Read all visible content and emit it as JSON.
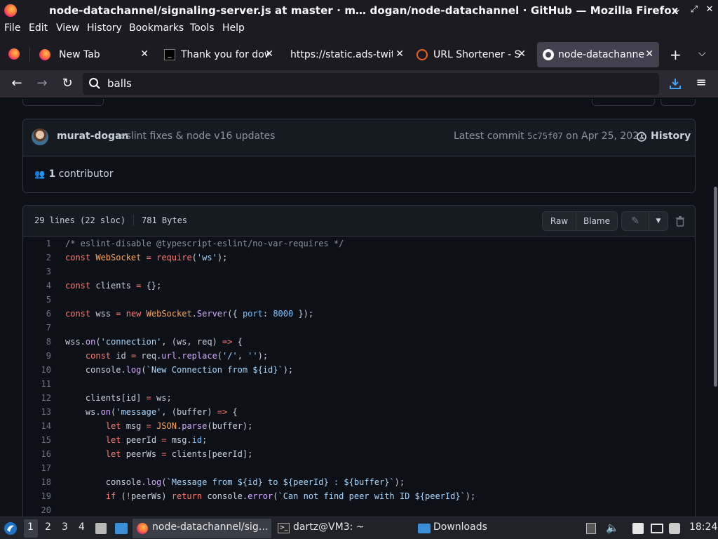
{
  "window": {
    "title": "node-datachannel/signaling-server.js at master · m…  dogan/node-datachannel · GitHub — Mozilla Firefox"
  },
  "menubar": [
    "File",
    "Edit",
    "View",
    "History",
    "Bookmarks",
    "Tools",
    "Help"
  ],
  "tabs": [
    {
      "label": "New Tab",
      "icon": "firefox-icon",
      "active": false
    },
    {
      "label": "Thank you for dow",
      "icon": "terminal-icon",
      "active": false
    },
    {
      "label": "https://static.ads-twit",
      "icon": "none",
      "active": false
    },
    {
      "label": "URL Shortener - St",
      "icon": "bitly-icon",
      "active": false
    },
    {
      "label": "node-datachannel",
      "icon": "github-icon",
      "active": true
    }
  ],
  "navbar": {
    "url_text": "balls"
  },
  "commit": {
    "author": "murat-dogan",
    "message": "eslint fixes & node v16 updates",
    "latest_prefix": "Latest commit",
    "sha": "5c75f07",
    "date_text": "on Apr 25, 2022",
    "history_label": "History",
    "contributors_count": "1",
    "contributors_label": "contributor"
  },
  "file": {
    "lines_info": "29 lines (22 sloc)",
    "size": "781 Bytes",
    "raw_label": "Raw",
    "blame_label": "Blame"
  },
  "code_lines": [
    {
      "n": "1",
      "code": "/* eslint-disable @typescript-eslint/no-var-requires */"
    },
    {
      "n": "2",
      "code": "const WebSocket = require('ws');"
    },
    {
      "n": "3",
      "code": ""
    },
    {
      "n": "4",
      "code": "const clients = {};"
    },
    {
      "n": "5",
      "code": ""
    },
    {
      "n": "6",
      "code": "const wss = new WebSocket.Server({ port: 8000 });"
    },
    {
      "n": "7",
      "code": ""
    },
    {
      "n": "8",
      "code": "wss.on('connection', (ws, req) => {"
    },
    {
      "n": "9",
      "code": "    const id = req.url.replace('/', '');"
    },
    {
      "n": "10",
      "code": "    console.log(`New Connection from ${id}`);"
    },
    {
      "n": "11",
      "code": ""
    },
    {
      "n": "12",
      "code": "    clients[id] = ws;"
    },
    {
      "n": "13",
      "code": "    ws.on('message', (buffer) => {"
    },
    {
      "n": "14",
      "code": "        let msg = JSON.parse(buffer);"
    },
    {
      "n": "15",
      "code": "        let peerId = msg.id;"
    },
    {
      "n": "16",
      "code": "        let peerWs = clients[peerId];"
    },
    {
      "n": "17",
      "code": ""
    },
    {
      "n": "18",
      "code": "        console.log(`Message from ${id} to ${peerId} : ${buffer}`);"
    },
    {
      "n": "19",
      "code": "        if (!peerWs) return console.error(`Can not find peer with ID ${peerId}`);"
    },
    {
      "n": "20",
      "code": ""
    }
  ],
  "taskbar": {
    "workspaces": [
      "1",
      "2",
      "3",
      "4"
    ],
    "tasks": [
      {
        "label": "node-datachannel/sig…",
        "icon": "firefox-icon"
      },
      {
        "label": "dartz@VM3: ~",
        "icon": "terminal-icon"
      },
      {
        "label": "Downloads",
        "icon": "folder-icon"
      }
    ],
    "clock": "18:24"
  },
  "colors": {
    "page_bg": "#0d1117",
    "keyword": "#ff7b72",
    "string": "#a5d6ff",
    "entity": "#ffa657",
    "function": "#d2a8ff",
    "constant": "#79c0ff",
    "comment": "#8b949e"
  }
}
